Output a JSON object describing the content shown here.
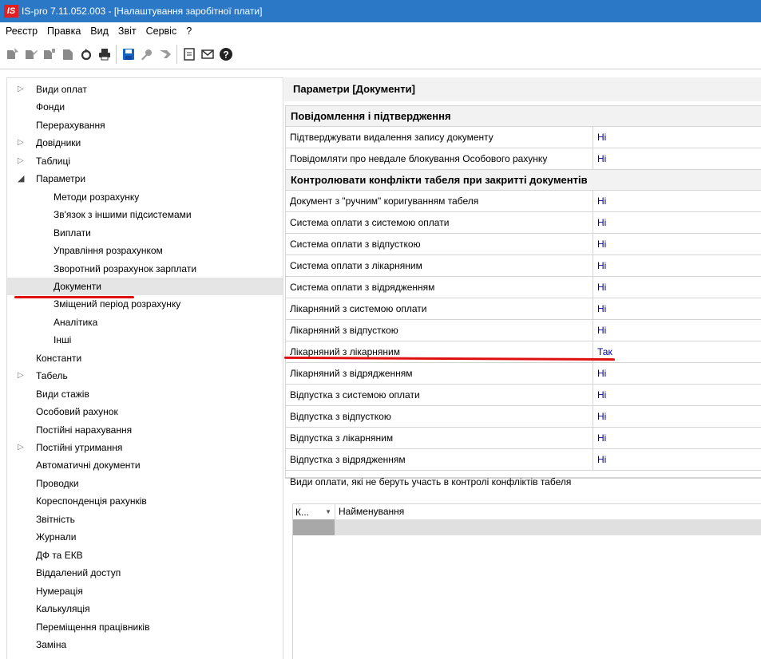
{
  "window": {
    "logo": "IS",
    "title": "IS-pro 7.11.052.003 - [Налаштування заробітної плати]"
  },
  "menu": [
    "Реєстр",
    "Правка",
    "Вид",
    "Звіт",
    "Сервіс",
    "?"
  ],
  "toolbar": {
    "icons": [
      "create-icon",
      "edit-icon",
      "copy-icon",
      "delete-icon",
      "refresh-icon",
      "print-icon",
      "save-icon",
      "find-icon",
      "filter-icon",
      "form-icon",
      "email-icon",
      "help-icon"
    ]
  },
  "tree": [
    {
      "label": "Види оплат",
      "level": 0,
      "arrow": "collapsed"
    },
    {
      "label": "Фонди",
      "level": 0,
      "arrow": "none"
    },
    {
      "label": "Перерахування",
      "level": 0,
      "arrow": "none"
    },
    {
      "label": "Довідники",
      "level": 0,
      "arrow": "collapsed"
    },
    {
      "label": "Таблиці",
      "level": 0,
      "arrow": "collapsed"
    },
    {
      "label": "Параметри",
      "level": 0,
      "arrow": "expanded"
    },
    {
      "label": "Методи розрахунку",
      "level": 1,
      "arrow": "none"
    },
    {
      "label": "Зв'язок з іншими підсистемами",
      "level": 1,
      "arrow": "none"
    },
    {
      "label": "Виплати",
      "level": 1,
      "arrow": "none"
    },
    {
      "label": "Управління розрахунком",
      "level": 1,
      "arrow": "none"
    },
    {
      "label": "Зворотний розрахунок зарплати",
      "level": 1,
      "arrow": "none"
    },
    {
      "label": "Документи",
      "level": 1,
      "arrow": "none",
      "selected": true
    },
    {
      "label": "Зміщений період розрахунку",
      "level": 1,
      "arrow": "none"
    },
    {
      "label": "Аналітика",
      "level": 1,
      "arrow": "none"
    },
    {
      "label": "Інші",
      "level": 1,
      "arrow": "none"
    },
    {
      "label": "Константи",
      "level": 0,
      "arrow": "none"
    },
    {
      "label": "Табель",
      "level": 0,
      "arrow": "collapsed"
    },
    {
      "label": "Види стажів",
      "level": 0,
      "arrow": "none"
    },
    {
      "label": "Особовий рахунок",
      "level": 0,
      "arrow": "none"
    },
    {
      "label": "Постійні нарахування",
      "level": 0,
      "arrow": "none"
    },
    {
      "label": "Постійні утримання",
      "level": 0,
      "arrow": "collapsed"
    },
    {
      "label": "Автоматичні документи",
      "level": 0,
      "arrow": "none"
    },
    {
      "label": "Проводки",
      "level": 0,
      "arrow": "none"
    },
    {
      "label": "Кореспонденція рахунків",
      "level": 0,
      "arrow": "none"
    },
    {
      "label": "Звітність",
      "level": 0,
      "arrow": "none"
    },
    {
      "label": "Журнали",
      "level": 0,
      "arrow": "none"
    },
    {
      "label": "ДФ та ЕКВ",
      "level": 0,
      "arrow": "none"
    },
    {
      "label": "Віддалений доступ",
      "level": 0,
      "arrow": "none"
    },
    {
      "label": "Нумерація",
      "level": 0,
      "arrow": "none"
    },
    {
      "label": "Калькуляція",
      "level": 0,
      "arrow": "none"
    },
    {
      "label": "Переміщення працівників",
      "level": 0,
      "arrow": "none"
    },
    {
      "label": "Заміна",
      "level": 0,
      "arrow": "none"
    }
  ],
  "params": {
    "header": "Параметри [Документи]",
    "rows": [
      {
        "type": "section",
        "label": "Повідомлення і підтвердження"
      },
      {
        "type": "param",
        "label": "Підтверджувати видалення запису документу",
        "value": "Ні"
      },
      {
        "type": "param",
        "label": "Повідомляти про невдале блокування Особового рахунку",
        "value": "Ні"
      },
      {
        "type": "section",
        "label": "Контролювати конфлікти табеля при закритті документів"
      },
      {
        "type": "param",
        "label": "Документ з \"ручним\" коригуванням табеля",
        "value": "Ні"
      },
      {
        "type": "param",
        "label": "Система оплати з системою оплати",
        "value": "Ні"
      },
      {
        "type": "param",
        "label": "Система оплати з відпусткою",
        "value": "Ні"
      },
      {
        "type": "param",
        "label": "Система оплати з лікарняним",
        "value": "Ні"
      },
      {
        "type": "param",
        "label": "Система оплати з відрядженням",
        "value": "Ні"
      },
      {
        "type": "param",
        "label": "Лікарняний з системою оплати",
        "value": "Ні"
      },
      {
        "type": "param",
        "label": "Лікарняний з відпусткою",
        "value": "Ні"
      },
      {
        "type": "param",
        "label": "Лікарняний з лікарняним",
        "value": "Так"
      },
      {
        "type": "param",
        "label": "Лікарняний з відрядженням",
        "value": "Ні"
      },
      {
        "type": "param",
        "label": "Відпустка з системою оплати",
        "value": "Ні"
      },
      {
        "type": "param",
        "label": "Відпустка з відпусткою",
        "value": "Ні"
      },
      {
        "type": "param",
        "label": "Відпустка з лікарняним",
        "value": "Ні"
      },
      {
        "type": "param",
        "label": "Відпустка з відрядженням",
        "value": "Ні"
      }
    ]
  },
  "excluded": {
    "title": "Види оплати, які не беруть участь в контролі конфліктів табеля",
    "col_code": "К...",
    "col_name": "Найменування"
  },
  "colors": {
    "titlebar": "#2b78c7",
    "value_text": "#0000a0",
    "annotation": "#e01010"
  }
}
